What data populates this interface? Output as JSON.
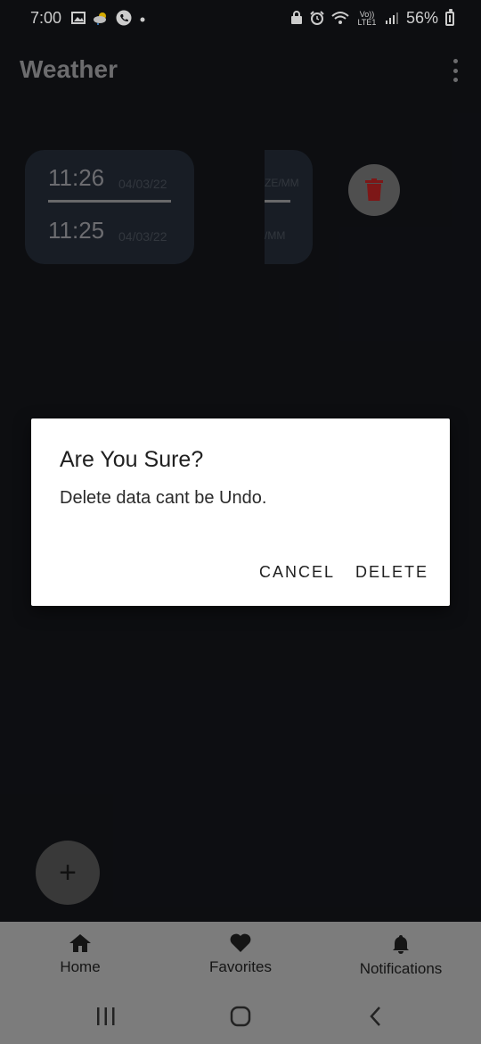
{
  "status_bar": {
    "time": "7:00",
    "battery": "56%",
    "left_icons": [
      "image-icon",
      "weather-icon",
      "phone-call-icon",
      "dot-icon"
    ],
    "right_icons": [
      "lock-icon",
      "alarm-icon",
      "wifi-icon",
      "volte-icon",
      "signal-icon",
      "battery-icon"
    ],
    "volte_label": "Vo)) LTE1"
  },
  "app_bar": {
    "title": "Weather",
    "menu_icon": "more-vert-icon"
  },
  "history": {
    "entries": [
      {
        "time": "11:26",
        "date": "04/03/22"
      },
      {
        "time": "11:25",
        "date": "04/03/22"
      }
    ],
    "card2_lines": [
      "ZE/MM",
      "/MM"
    ],
    "delete_icon": "trash-icon",
    "delete_color": "#c62828"
  },
  "dialog": {
    "title": "Are You Sure?",
    "message": "Delete data cant be Undo.",
    "cancel_label": "CANCEL",
    "delete_label": "DELETE"
  },
  "fab": {
    "label": "+"
  },
  "bottom_nav": {
    "items": [
      {
        "label": "Home",
        "icon": "home-icon"
      },
      {
        "label": "Favorites",
        "icon": "heart-icon"
      },
      {
        "label": "Notifications",
        "icon": "bell-icon"
      }
    ]
  },
  "system_nav": [
    "recents-icon",
    "home-circle-icon",
    "back-icon"
  ]
}
